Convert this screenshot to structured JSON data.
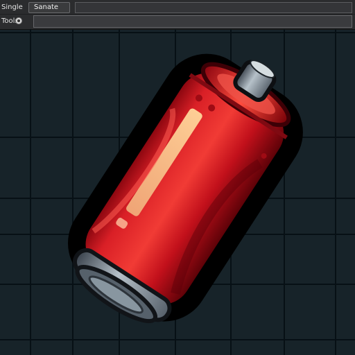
{
  "toolbar": {
    "mode_label": "Single",
    "sprite_dropdown": "Sanate",
    "tools_label": "Tools"
  },
  "colors": {
    "background": "#172329",
    "grid_line": "#071014",
    "battery_red": "#d91f26",
    "battery_dark": "#8d0710",
    "highlight": "#ffcf8a",
    "metal": "#7a8795"
  },
  "icons": {
    "tool_toggle": "radio-button-icon"
  },
  "canvas": {
    "subject": "red-battery-sprite"
  }
}
